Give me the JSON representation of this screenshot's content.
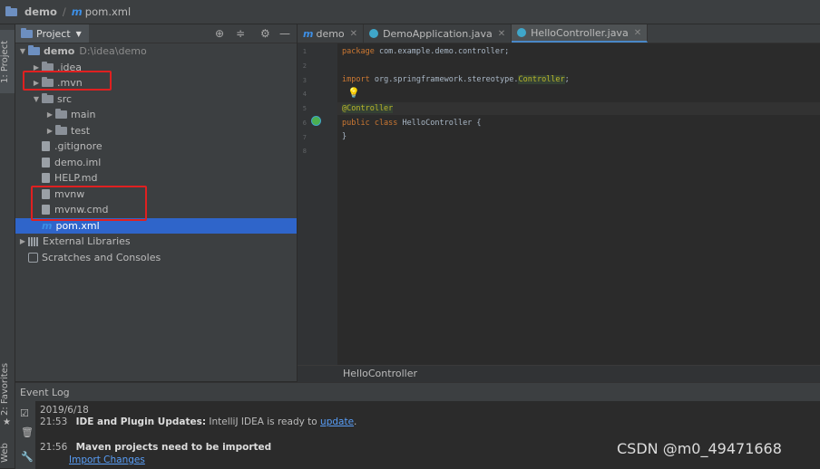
{
  "titlebar": {
    "project": "demo",
    "file": "pom.xml"
  },
  "leftstrip": {
    "project_tab": "1: Project",
    "favorites_tab": "2: Favorites",
    "web_tab": "Web"
  },
  "project_panel": {
    "title": "Project",
    "tree": [
      {
        "label": "demo",
        "extra": "D:\\idea\\demo",
        "kind": "module",
        "depth": 0,
        "arrow": "down"
      },
      {
        "label": ".idea",
        "kind": "folder",
        "depth": 1,
        "arrow": "right"
      },
      {
        "label": ".mvn",
        "kind": "folder",
        "depth": 1,
        "arrow": "right"
      },
      {
        "label": "src",
        "kind": "folder",
        "depth": 1,
        "arrow": "down"
      },
      {
        "label": "main",
        "kind": "folder",
        "depth": 2,
        "arrow": "right"
      },
      {
        "label": "test",
        "kind": "folder",
        "depth": 2,
        "arrow": "right"
      },
      {
        "label": ".gitignore",
        "kind": "file",
        "depth": 1,
        "arrow": ""
      },
      {
        "label": "demo.iml",
        "kind": "file",
        "depth": 1,
        "arrow": ""
      },
      {
        "label": "HELP.md",
        "kind": "file",
        "depth": 1,
        "arrow": ""
      },
      {
        "label": "mvnw",
        "kind": "file",
        "depth": 1,
        "arrow": ""
      },
      {
        "label": "mvnw.cmd",
        "kind": "file",
        "depth": 1,
        "arrow": ""
      },
      {
        "label": "pom.xml",
        "kind": "maven",
        "depth": 1,
        "arrow": "",
        "selected": true
      },
      {
        "label": "External Libraries",
        "kind": "lib",
        "depth": 0,
        "arrow": "right"
      },
      {
        "label": "Scratches and Consoles",
        "kind": "scratch",
        "depth": 0,
        "arrow": ""
      }
    ]
  },
  "editor": {
    "tabs": [
      {
        "label": "demo",
        "icon": "maven-icon",
        "active": false
      },
      {
        "label": "DemoApplication.java",
        "icon": "java-class-icon",
        "active": false
      },
      {
        "label": "HelloController.java",
        "icon": "java-class-icon",
        "active": true
      }
    ],
    "line_numbers": [
      "1",
      "2",
      "3",
      "4",
      "5",
      "6",
      "7",
      "8"
    ],
    "lines": {
      "l1_kw": "package",
      "l1_rest": " com.example.demo.controller;",
      "l3_kw": "import",
      "l3_rest": " org.springframework.stereotype.",
      "l3_cls": "Controller",
      "l3_end": ";",
      "l5": "@Controller",
      "l6_kw": "public class",
      "l6_rest": " HelloController {",
      "l7": "}"
    },
    "breadcrumb": "HelloController"
  },
  "event_log": {
    "title": "Event Log",
    "date": "2019/6/18",
    "entries": [
      {
        "time": "21:53",
        "title": "IDE and Plugin Updates:",
        "text": " IntelliJ IDEA is ready to ",
        "link": "update",
        "end": "."
      },
      {
        "time": "21:56",
        "title": "Maven projects need to be imported",
        "link": "Import Changes"
      }
    ]
  },
  "watermark": "CSDN @m0_49471668",
  "colors": {
    "accent": "#2f65ca",
    "highlight_box": "#e02020",
    "keyword": "#cc7832",
    "annotation": "#bbb529"
  }
}
